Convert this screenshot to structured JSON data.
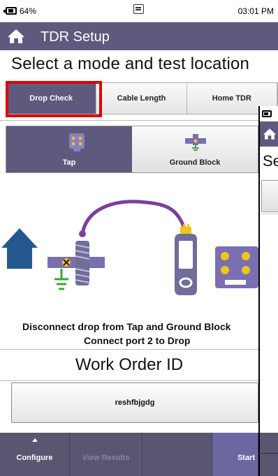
{
  "status_bar": {
    "battery": "64%",
    "time": "03:01 PM",
    "battery_icon": "battery-icon",
    "keyboard_icon": "keyboard-icon"
  },
  "title_bar": {
    "title": "TDR Setup",
    "home_icon": "home-icon"
  },
  "heading": "Select a mode and test location",
  "mode_tabs": [
    {
      "label": "Drop Check",
      "active": true
    },
    {
      "label": "Cable Length",
      "active": false
    },
    {
      "label": "Home TDR",
      "active": false
    }
  ],
  "location_tabs": [
    {
      "label": "Tap",
      "active": true,
      "icon": "tap-icon"
    },
    {
      "label": "Ground Block",
      "active": false,
      "icon": "ground-block-icon"
    }
  ],
  "instructions": {
    "line1": "Disconnect drop from Tap and Ground Block",
    "line2": "Connect port 2 to Drop"
  },
  "work_order": {
    "label": "Work Order ID",
    "value": "reshfbjgdg"
  },
  "bottom_bar": {
    "configure": "Configure",
    "view_results": "View Results",
    "start": "Start"
  },
  "second_screen": {
    "heading": "Se"
  },
  "colors": {
    "header": "#5e5a7e",
    "accent": "#7a5fa8",
    "highlight": "#e00000",
    "cable": "#7b3fa0",
    "house": "#24588f",
    "ground": "#3aa53a",
    "connector": "#f0c419"
  }
}
